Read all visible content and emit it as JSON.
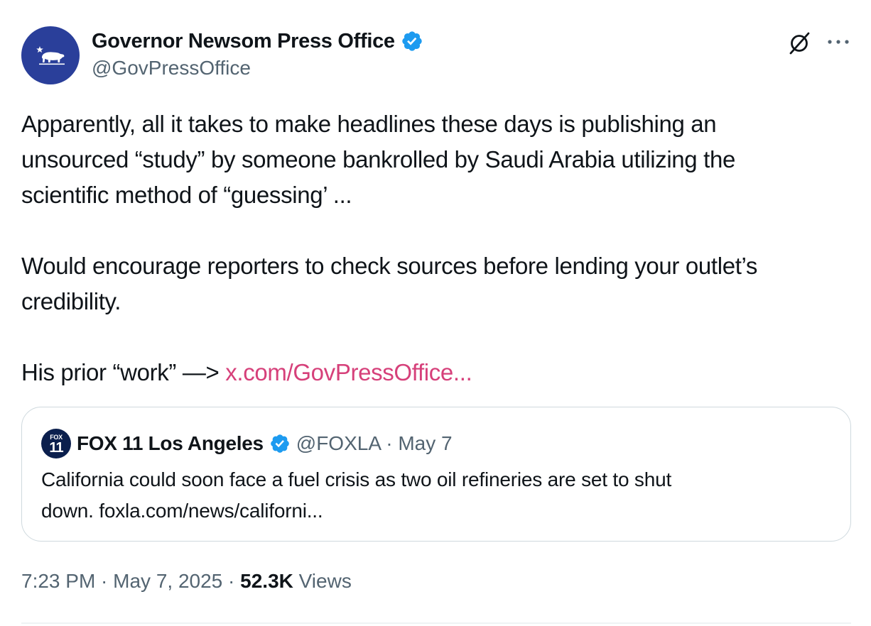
{
  "author": {
    "display_name": "Governor Newsom Press Office",
    "handle": "@GovPressOffice",
    "verified": true,
    "avatar_icon": "california-bear-icon",
    "avatar_color": "#2a3f9a"
  },
  "actions": {
    "grok_icon": "grok-icon",
    "more_icon": "more-horizontal-icon",
    "more_label": "···"
  },
  "tweet": {
    "paragraph1_line1": "Apparently, all it takes to make headlines these days is publishing an",
    "paragraph1_line2": "unsourced “study” by someone bankrolled by Saudi Arabia utilizing the",
    "paragraph1_line3": "scientific method of “guessing’ ...",
    "paragraph2_line1": "Would encourage reporters to check sources before lending your outlet’s",
    "paragraph2_line2": "credibility.",
    "paragraph3_prefix": "His prior “work” —> ",
    "paragraph3_link": "x.com/GovPressOffice..."
  },
  "quote": {
    "logo_word": "FOX",
    "logo_number": "11",
    "display_name": "FOX 11 Los Angeles",
    "verified": true,
    "handle_and_date": "@FOXLA · May 7",
    "text_line1": "California could soon face a fuel crisis as two oil refineries are set to shut",
    "text_line2": "down. foxla.com/news/californi..."
  },
  "meta": {
    "time_date": "7:23 PM · May 7, 2025 · ",
    "views_count": "52.3K",
    "views_label": " Views"
  },
  "colors": {
    "link": "#d6407a",
    "verified_badge": "#1d9bf0",
    "secondary_text": "#536471",
    "primary_text": "#0f1419",
    "fox_logo_bg": "#0b1f4d"
  }
}
